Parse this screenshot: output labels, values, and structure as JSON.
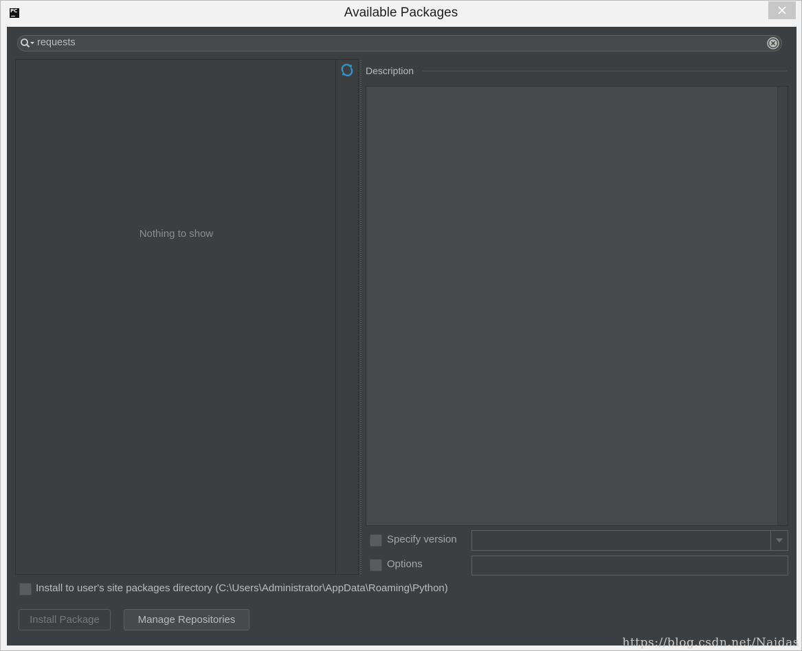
{
  "window": {
    "title": "Available Packages",
    "app_icon_label": "PC"
  },
  "search": {
    "value": "requests"
  },
  "package_list": {
    "empty_text": "Nothing to show"
  },
  "description": {
    "label": "Description"
  },
  "options": {
    "specify_version_label": "Specify version",
    "specify_version_checked": false,
    "options_label": "Options",
    "options_checked": false,
    "version_value": "",
    "options_value": ""
  },
  "install_user": {
    "label": "Install to user's site packages directory (C:\\Users\\Administrator\\AppData\\Roaming\\Python)",
    "checked": false
  },
  "buttons": {
    "install_label": "Install Package",
    "manage_label": "Manage Repositories"
  },
  "watermark": "https://blog.csdn.net/Naidas",
  "colors": {
    "background": "#3c3f41",
    "field": "#45494a",
    "text": "#bbbbbb",
    "accent": "#3592c4"
  },
  "icons": {
    "search": "search-icon",
    "clear": "clear-icon",
    "refresh": "refresh-icon",
    "close": "close-icon",
    "dropdown": "chevron-down-icon"
  }
}
